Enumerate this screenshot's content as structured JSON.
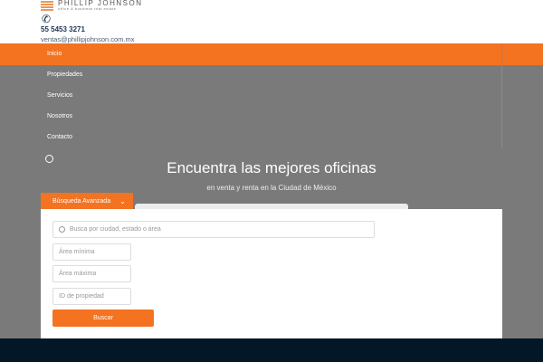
{
  "brand": {
    "name": "PHILLIP JOHNSON",
    "tagline": "office & business real estate"
  },
  "contact": {
    "phone": "55 5453 3271",
    "email": "ventas@phillipjohnson.com.mx"
  },
  "nav": [
    "Inicio",
    "Propiedades",
    "Servicios",
    "Nosotros",
    "Contacto"
  ],
  "hero": {
    "title": "Encuentra las mejores oficinas",
    "subtitle": "en venta y renta en la Ciudad de México"
  },
  "search": {
    "tab_label": "Búsqueda Avanzada",
    "query_placeholder": "Busca por ciudad, estado o área",
    "min_area_placeholder": "Área mínima",
    "max_area_placeholder": "Área máxima",
    "id_placeholder": "ID de propiedad",
    "submit_label": "Buscar"
  },
  "colors": {
    "accent": "#f37321",
    "footer": "#041727"
  }
}
